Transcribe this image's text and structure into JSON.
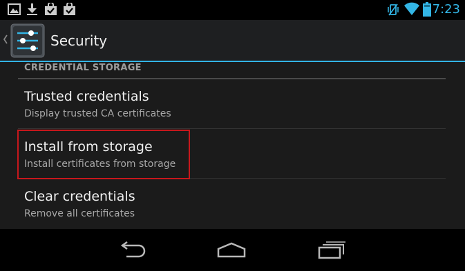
{
  "status_bar": {
    "time": "7:23",
    "left_icons": [
      "image-icon",
      "download-icon",
      "shopping-bag-check-icon",
      "shopping-bag-check-icon"
    ],
    "right_icons": [
      "vibrate-off-icon",
      "wifi-icon",
      "battery-icon"
    ],
    "accent_color": "#33b5e5"
  },
  "action_bar": {
    "title": "Security",
    "icon": "settings-sliders-icon"
  },
  "section": {
    "header": "CREDENTIAL STORAGE",
    "items": [
      {
        "title": "Trusted credentials",
        "summary": "Display trusted CA certificates"
      },
      {
        "title": "Install from storage",
        "summary": "Install certificates from storage"
      },
      {
        "title": "Clear credentials",
        "summary": "Remove all certificates"
      }
    ]
  },
  "highlight_color": "#c8171c",
  "nav_bar": {
    "buttons": [
      "back-icon",
      "home-icon",
      "recent-apps-icon"
    ]
  }
}
